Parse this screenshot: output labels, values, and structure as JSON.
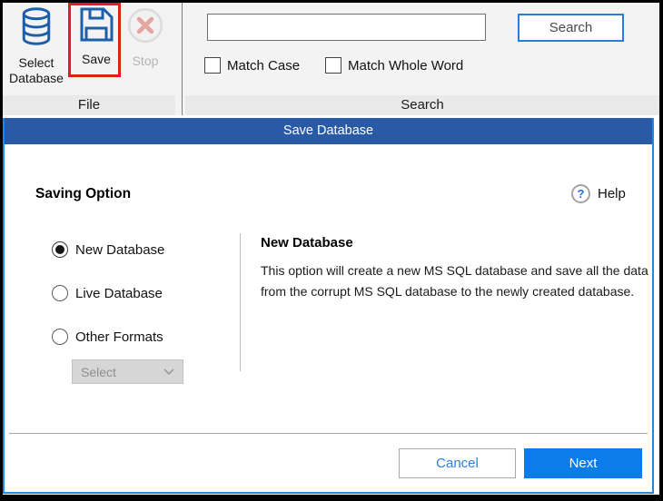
{
  "window": {
    "ribbon": {
      "file_group": {
        "label": "File",
        "select_database_button": {
          "label": "Select Database"
        },
        "save_button": {
          "label": "Save",
          "highlighted": true
        },
        "stop_button": {
          "label": "Stop",
          "enabled": false
        }
      },
      "search_group": {
        "label": "Search",
        "input_value": "",
        "search_button_label": "Search",
        "match_case": {
          "label": "Match Case",
          "checked": false
        },
        "match_whole_word": {
          "label": "Match Whole Word",
          "checked": false
        }
      }
    },
    "dialog": {
      "title": "Save Database",
      "section_heading": "Saving Option",
      "help_icon_glyph": "?",
      "help_label": "Help",
      "options": [
        {
          "label": "New Database",
          "selected": true
        },
        {
          "label": "Live Database",
          "selected": false
        },
        {
          "label": "Other Formats",
          "selected": false
        }
      ],
      "format_select": {
        "value": "Select",
        "enabled": false
      },
      "detail": {
        "heading": "New Database",
        "description": "This option will create a new MS SQL database and save all the data from the corrupt MS SQL database to the newly created database."
      },
      "footer": {
        "cancel_label": "Cancel",
        "next_label": "Next"
      }
    },
    "colors": {
      "title_bar_blue": "#2a5aa5",
      "dialog_border_blue": "#1e88e5",
      "primary_button_blue": "#0b7ce8",
      "icon_blue": "#1d5fa8",
      "annotation_red": "#e31c1c"
    }
  }
}
